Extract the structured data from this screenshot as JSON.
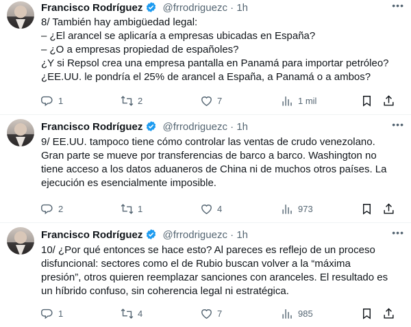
{
  "author": {
    "name": "Francisco Rodríguez",
    "handle": "@frrodriguezc",
    "separator": "·"
  },
  "tweets": [
    {
      "time": "1h",
      "lines": [
        "8/ También hay ambigüedad legal:",
        "– ¿El arancel se aplicaría a empresas ubicadas en España?",
        "– ¿O a empresas propiedad de españoles?",
        "¿Y si Repsol crea una empresa pantalla en Panamá para importar petróleo?",
        "¿EE.UU. le pondría el 25% de arancel a España, a Panamá o a ambos?"
      ],
      "replies": "1",
      "retweets": "2",
      "likes": "7",
      "views": "1 mil"
    },
    {
      "time": "1h",
      "lines": [
        "9/ EE.UU. tampoco tiene cómo controlar las ventas de crudo venezolano.",
        "Gran parte se mueve por transferencias de barco a barco. Washington no",
        "tiene acceso a los datos aduaneros de China ni de muchos otros países. La",
        "ejecución es esencialmente imposible."
      ],
      "replies": "2",
      "retweets": "1",
      "likes": "4",
      "views": "973"
    },
    {
      "time": "1h",
      "lines": [
        "10/ ¿Por qué entonces se hace esto? Al pareces es reflejo de un proceso",
        "disfuncional: sectores como el de Rubio buscan volver a la “máxima",
        "presión”, otros quieren reemplazar sanciones con aranceles. El resultado es",
        "un híbrido confuso, sin coherencia legal ni estratégica."
      ],
      "replies": "1",
      "retweets": "4",
      "likes": "7",
      "views": "985"
    }
  ],
  "icons": {
    "more": "more-icon",
    "reply": "reply-icon",
    "retweet": "retweet-icon",
    "like": "like-icon",
    "views": "views-icon",
    "bookmark": "bookmark-icon",
    "share": "share-icon",
    "verified": "verified-badge-icon"
  },
  "colors": {
    "verified": "#1d9bf0",
    "muted": "#536471",
    "text": "#0f1419"
  }
}
